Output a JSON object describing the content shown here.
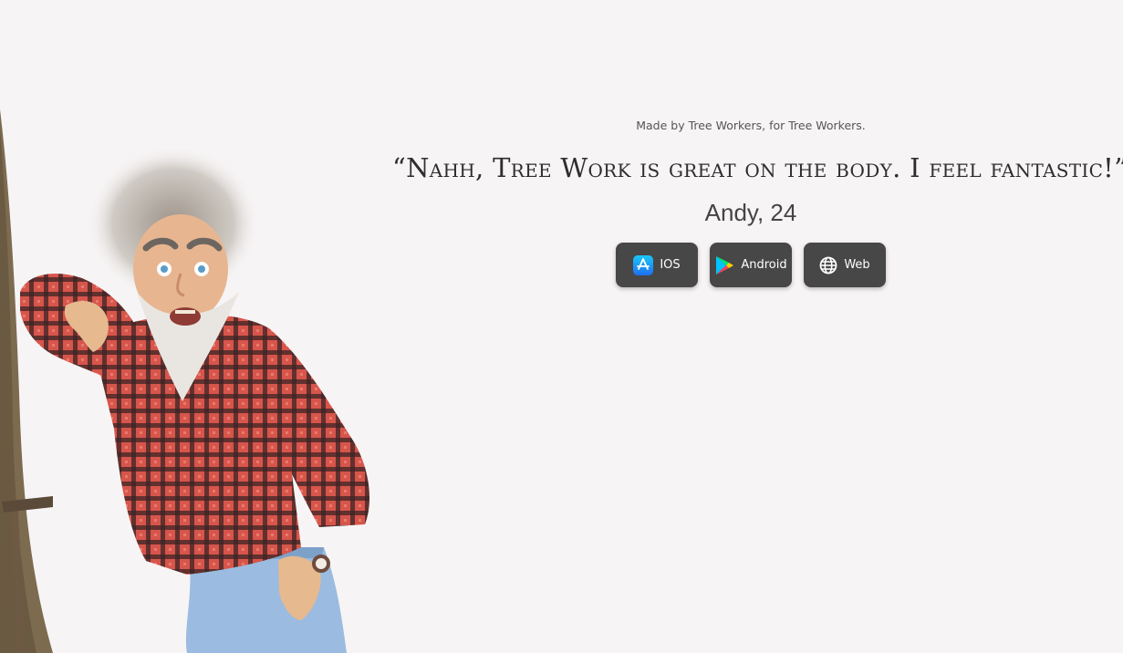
{
  "hero": {
    "tagline": "Made by Tree Workers, for Tree Workers.",
    "quote": "“Nahh, Tree Work is great on the body. I feel fantastic!”",
    "attribution": "Andy, 24"
  },
  "buttons": [
    {
      "label": "IOS",
      "icon": "app-store-icon"
    },
    {
      "label": "Android",
      "icon": "google-play-icon"
    },
    {
      "label": "Web",
      "icon": "globe-icon"
    }
  ],
  "colors": {
    "background": "#f7f4f5",
    "button_bg": "#474747",
    "button_text": "#ffffff",
    "shirt_red": "#c9483f",
    "jeans_blue": "#8fb3d9",
    "tree_bark": "#7b6a4f"
  }
}
